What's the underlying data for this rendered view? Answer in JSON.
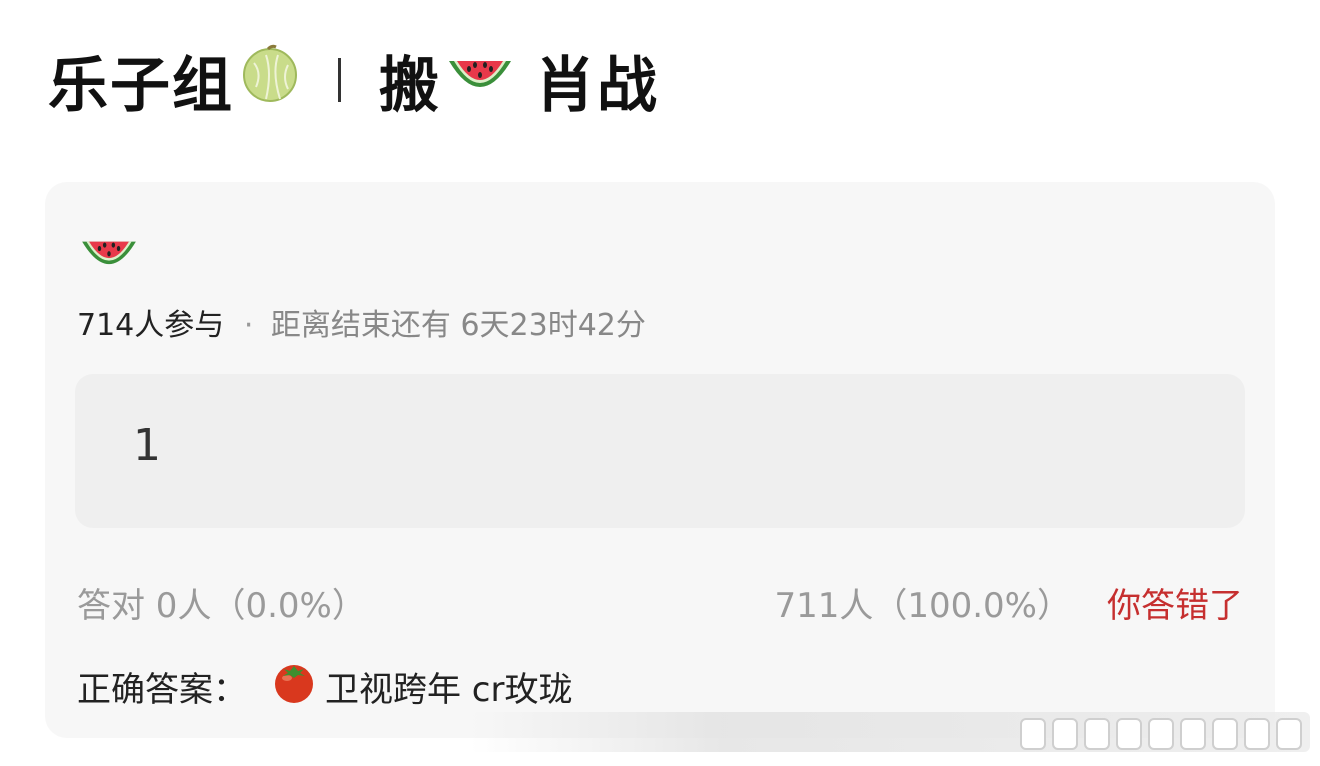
{
  "title": {
    "part1": "乐子组",
    "part1_icon": "melon-icon",
    "part2": "搬",
    "part2_icon": "watermelon-icon",
    "part3": "肖战"
  },
  "poll": {
    "header_icon": "watermelon-icon",
    "participants": "714人参与",
    "separator": "·",
    "countdown": "距离结束还有 6天23时42分",
    "option_label": "1",
    "correct_stats": "答对  0人（0.0%）",
    "option_stats": "711人（100.0%）",
    "result_label": "你答错了",
    "answer_prefix": "正确答案：",
    "answer_icon": "tomato-icon",
    "answer_text": "卫视跨年 cr玫珑"
  },
  "colors": {
    "card_bg": "#f7f7f7",
    "option_bg": "#efefef",
    "wrong": "#c62f2f",
    "muted": "#9a9a9a"
  }
}
